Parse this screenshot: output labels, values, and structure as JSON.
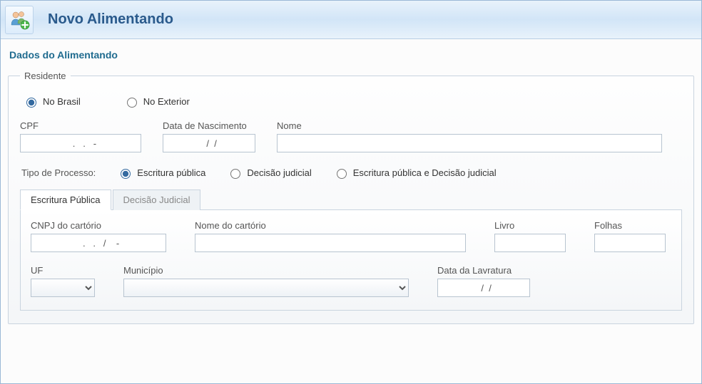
{
  "header": {
    "title": "Novo Alimentando",
    "icon": "people-add-icon"
  },
  "section": {
    "title": "Dados do Alimentando"
  },
  "residente": {
    "legend": "Residente",
    "options": [
      {
        "label": "No Brasil",
        "value": "brasil",
        "checked": true
      },
      {
        "label": "No Exterior",
        "value": "exterior",
        "checked": false
      }
    ]
  },
  "fields": {
    "cpf": {
      "label": "CPF",
      "value": "   .   .   -"
    },
    "data_nascimento": {
      "label": "Data de Nascimento",
      "value": "  /  /"
    },
    "nome": {
      "label": "Nome",
      "value": ""
    }
  },
  "tipo_processo": {
    "label": "Tipo de Processo:",
    "options": [
      {
        "label": "Escritura pública",
        "checked": true
      },
      {
        "label": "Decisão judicial",
        "checked": false
      },
      {
        "label": "Escritura pública e Decisão judicial",
        "checked": false
      }
    ]
  },
  "tabs": [
    {
      "label": "Escritura Pública",
      "active": true
    },
    {
      "label": "Decisão Judicial",
      "active": false
    }
  ],
  "escritura": {
    "cnpj": {
      "label": "CNPJ do cartório",
      "value": "  .   .   /    -"
    },
    "nome_cartorio": {
      "label": "Nome do cartório",
      "value": ""
    },
    "livro": {
      "label": "Livro",
      "value": ""
    },
    "folhas": {
      "label": "Folhas",
      "value": ""
    },
    "uf": {
      "label": "UF",
      "value": ""
    },
    "municipio": {
      "label": "Município",
      "value": ""
    },
    "data_lavratura": {
      "label": "Data da Lavratura",
      "value": "  /  /"
    }
  }
}
